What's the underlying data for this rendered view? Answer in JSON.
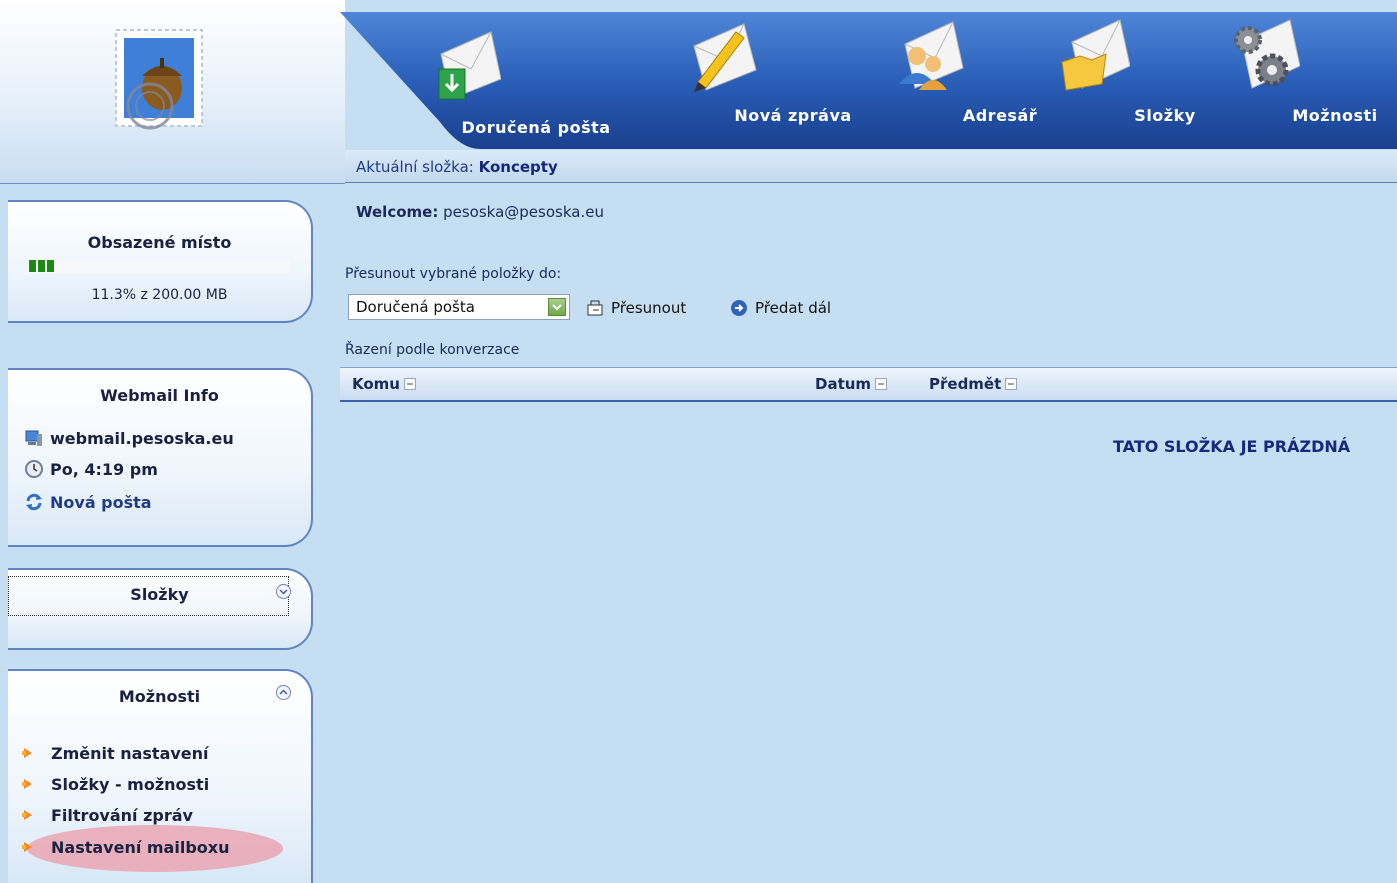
{
  "header": {
    "nav": [
      {
        "label": "Doručená pošta",
        "icon": "inbox-envelope-icon"
      },
      {
        "label": "Nová zpráva",
        "icon": "compose-pencil-icon"
      },
      {
        "label": "Adresář",
        "icon": "addressbook-people-icon"
      },
      {
        "label": "Složky",
        "icon": "folder-envelope-icon"
      },
      {
        "label": "Možnosti",
        "icon": "gears-envelope-icon"
      }
    ],
    "current_folder_label": "Aktuální složka:",
    "current_folder": "Koncepty"
  },
  "sidebar": {
    "quota": {
      "title": "Obsazené místo",
      "text": "11.3% z 200.00 MB",
      "fraction": 0.113
    },
    "info": {
      "title": "Webmail Info",
      "host": "webmail.pesoska.eu",
      "time": "Po, 4:19 pm",
      "new_mail": "Nová pošta"
    },
    "folders": {
      "title": "Složky"
    },
    "options": {
      "title": "Možnosti",
      "items": [
        "Změnit nastavení",
        "Složky - možnosti",
        "Filtrování zpráv",
        "Nastavení mailboxu"
      ]
    }
  },
  "main": {
    "welcome_label": "Welcome:",
    "welcome_user": "pesoska@pesoska.eu",
    "move_label": "Přesunout vybrané položky do:",
    "move_select_value": "Doručená pošta",
    "move_button": "Přesunout",
    "forward_button": "Předat dál",
    "sort_label": "Řazení podle konverzace",
    "columns": [
      "Komu",
      "Datum",
      "Předmět"
    ],
    "empty_message": "TATO SLOŽKA JE PRÁZDNÁ"
  },
  "colors": {
    "nav_blue": "#1f4fa8",
    "background": "#c5def2",
    "highlight": "#e9a9b6"
  }
}
